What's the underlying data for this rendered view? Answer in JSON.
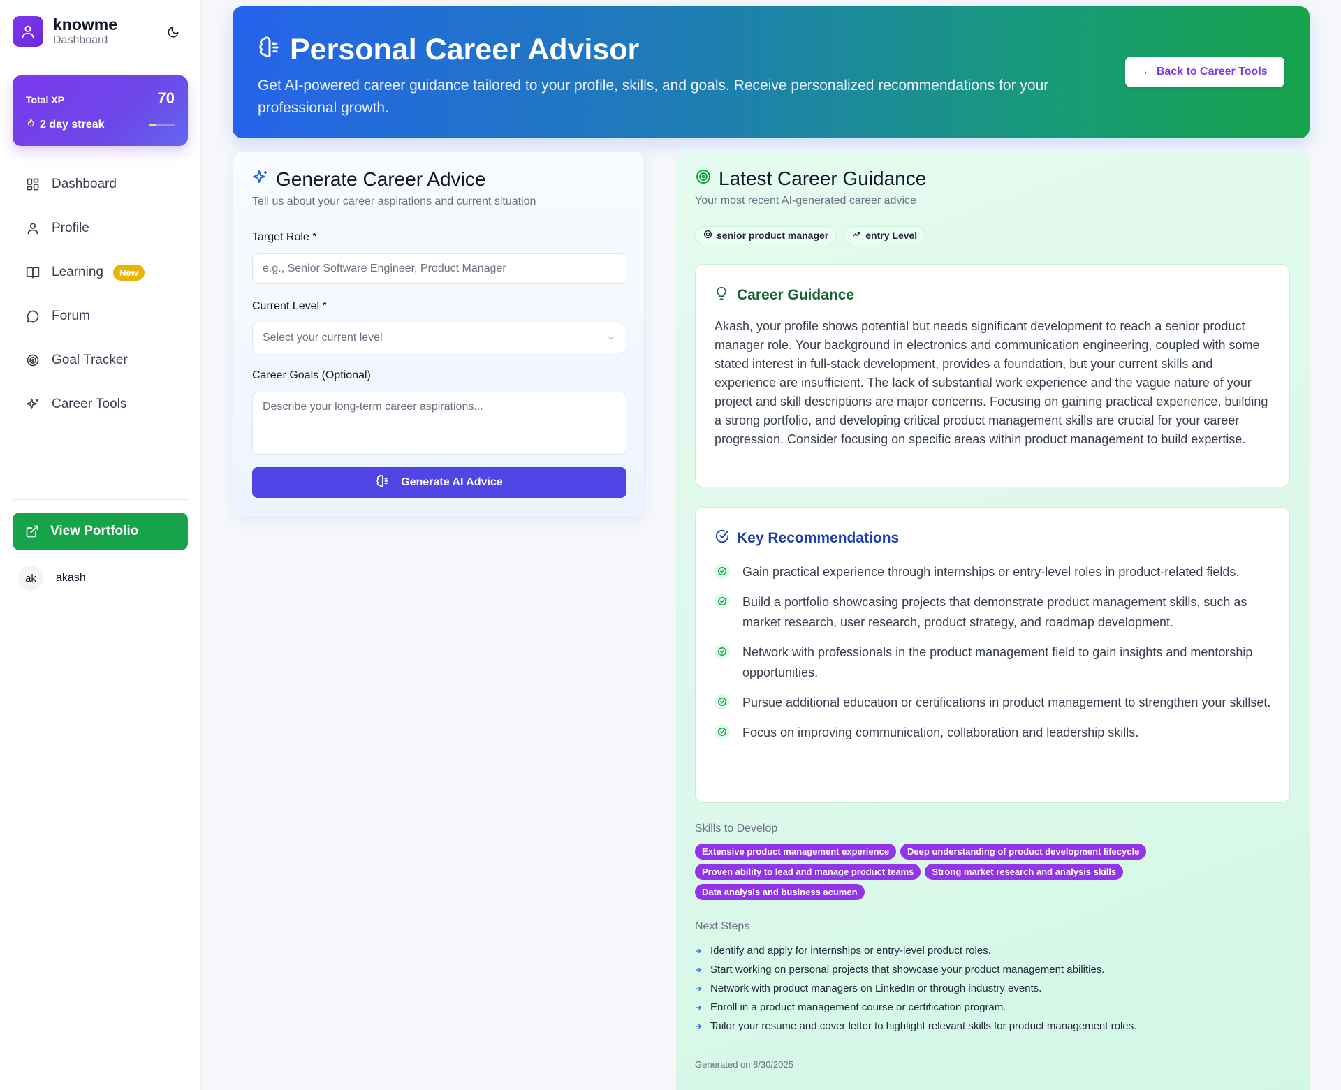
{
  "brand": {
    "name": "knowme",
    "subtitle": "Dashboard"
  },
  "xp": {
    "label": "Total XP",
    "value": "70",
    "streak": "2 day streak",
    "streak_progress": 0.28
  },
  "nav": [
    {
      "label": "Dashboard",
      "icon": "grid-icon"
    },
    {
      "label": "Profile",
      "icon": "user-icon"
    },
    {
      "label": "Learning",
      "icon": "book-icon",
      "badge": "New"
    },
    {
      "label": "Forum",
      "icon": "chat-icon"
    },
    {
      "label": "Goal Tracker",
      "icon": "target-icon"
    },
    {
      "label": "Career Tools",
      "icon": "sparkles-icon"
    }
  ],
  "portfolio": {
    "label": "View Portfolio"
  },
  "user": {
    "initials": "ak",
    "name": "akash"
  },
  "hero": {
    "title": "Personal Career Advisor",
    "description": "Get AI-powered career guidance tailored to your profile, skills, and goals. Receive personalized recommendations for your professional growth.",
    "back_label": "← Back to Career Tools"
  },
  "form": {
    "title": "Generate Career Advice",
    "subtitle": "Tell us about your career aspirations and current situation",
    "target_role_label": "Target Role *",
    "target_role_placeholder": "e.g., Senior Software Engineer, Product Manager",
    "current_level_label": "Current Level *",
    "current_level_value": "Select your current level",
    "goals_label": "Career Goals (Optional)",
    "goals_placeholder": "Describe your long-term career aspirations...",
    "submit_label": "Generate AI Advice"
  },
  "latest": {
    "title": "Latest Career Guidance",
    "subtitle": "Your most recent AI-generated career advice",
    "tags": [
      "senior product manager",
      "entry Level"
    ],
    "guidance_title": "Career Guidance",
    "guidance_text": "Akash, your profile shows potential but needs significant development to reach a senior product manager role.  Your background in electronics and communication engineering, coupled with some stated interest in full-stack development, provides a foundation, but your current skills and experience are insufficient. The lack of substantial work experience and the vague nature of your project and skill descriptions are major concerns.  Focusing on gaining practical experience, building a strong portfolio, and developing critical product management skills are crucial for your career progression.  Consider focusing on specific areas within product management to build expertise.",
    "recs_title": "Key Recommendations",
    "recommendations": [
      "Gain practical experience through internships or entry-level roles in product-related fields.",
      "Build a portfolio showcasing projects that demonstrate product management skills, such as market research, user research, product strategy, and roadmap development.",
      "Network with professionals in the product management field to gain insights and mentorship opportunities.",
      "Pursue additional education or certifications in product management to strengthen your skillset.",
      "Focus on improving communication, collaboration and leadership skills."
    ],
    "skills_label": "Skills to Develop",
    "skills": [
      "Extensive product management experience",
      "Deep understanding of product development lifecycle",
      "Proven ability to lead and manage product teams",
      "Strong market research and analysis skills",
      "Data analysis and business acumen"
    ],
    "steps_label": "Next Steps",
    "steps": [
      "Identify and apply for internships or entry-level product roles.",
      "Start working on personal projects that showcase your product management abilities.",
      "Network with product managers on LinkedIn or through industry events.",
      "Enroll in a product management course or certification program.",
      "Tailor your resume and cover letter to highlight relevant skills for product management roles."
    ],
    "generated": "Generated on 8/30/2025"
  }
}
